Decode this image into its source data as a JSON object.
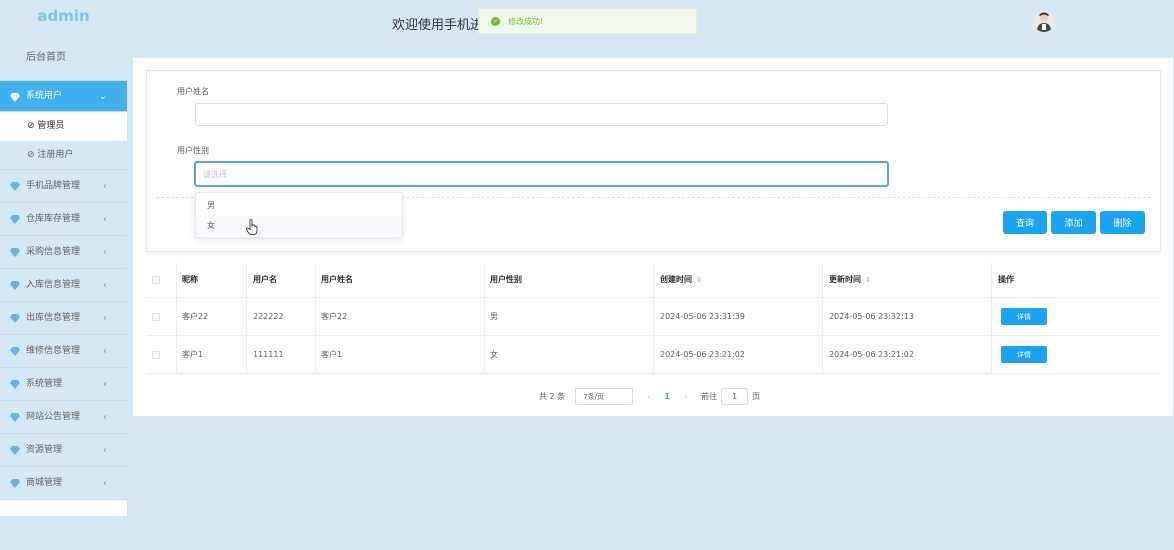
{
  "brand": "admin",
  "header": {
    "welcome": "欢迎使用手机进",
    "toast_message": "修改成功!"
  },
  "sidebar": {
    "home": "后台首页",
    "items": [
      {
        "label": "系统用户",
        "arrow": "⌄",
        "active": true
      },
      {
        "label": "手机品牌管理",
        "arrow": "‹"
      },
      {
        "label": "仓库库存管理",
        "arrow": "‹"
      },
      {
        "label": "采购信息管理",
        "arrow": "‹"
      },
      {
        "label": "入库信息管理",
        "arrow": "‹"
      },
      {
        "label": "出库信息管理",
        "arrow": "‹"
      },
      {
        "label": "维修信息管理",
        "arrow": "‹"
      },
      {
        "label": "系统管理",
        "arrow": "‹"
      },
      {
        "label": "网站公告管理",
        "arrow": "‹"
      },
      {
        "label": "资源管理",
        "arrow": "‹"
      },
      {
        "label": "商城管理",
        "arrow": "‹"
      }
    ],
    "sub_items": [
      "⊘ 管理员",
      "⊘ 注册用户"
    ]
  },
  "search": {
    "name_label": "用户姓名",
    "name_value": "",
    "gender_label": "用户性别",
    "gender_placeholder": "请选择",
    "options": [
      "男",
      "女"
    ],
    "buttons": {
      "query": "查询",
      "add": "添加",
      "delete": "删除"
    }
  },
  "table": {
    "headers": [
      "昵称",
      "用户名",
      "用户姓名",
      "用户性别",
      "创建时间",
      "更新时间",
      "操作"
    ],
    "sort_icon": "⇕",
    "rows": [
      {
        "nickname": "客户22",
        "username": "222222",
        "realname": "客户22",
        "gender": "男",
        "created": "2024-05-06 23:31:39",
        "updated": "2024-05-06 23:32:13",
        "action": "详情"
      },
      {
        "nickname": "客户1",
        "username": "111111",
        "realname": "客户1",
        "gender": "女",
        "created": "2024-05-06 23:21:02",
        "updated": "2024-05-06 23:21:02",
        "action": "详情"
      }
    ]
  },
  "pagination": {
    "total": "共 2 条",
    "page_size": "7条/页",
    "prev": "‹",
    "current": "1",
    "next": "›",
    "goto_prefix": "前往",
    "goto_value": "1",
    "goto_suffix": "页"
  },
  "colors": {
    "accent": "#1aa3f1",
    "sidebar_active": "#40b0ef",
    "page_bg": "#d4e8f5",
    "success": "#67c23a"
  }
}
